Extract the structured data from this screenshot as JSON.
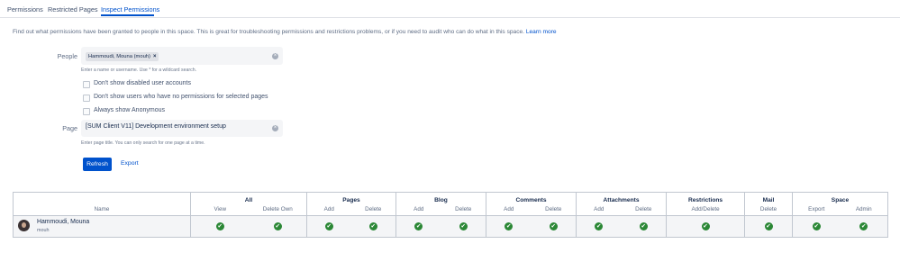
{
  "tabs": [
    {
      "label": "Permissions"
    },
    {
      "label": "Restricted Pages"
    },
    {
      "label": "Inspect Permissions"
    }
  ],
  "intro": {
    "text": "Find out what permissions have been granted to people in this space. This is great for troubleshooting permissions and restrictions problems, or if you need to audit who can do what in this space.",
    "link": "Learn more"
  },
  "people": {
    "label": "People",
    "chip": "Hammoudi, Mouna (mouh)",
    "hint": "Enter a name or username. Use * for a wildcard search."
  },
  "options": [
    {
      "label": "Don't show disabled user accounts"
    },
    {
      "label": "Don't show users who have no permissions for selected pages"
    },
    {
      "label": "Always show Anonymous"
    }
  ],
  "page": {
    "label": "Page",
    "value": "[SUM Client V11] Development environment setup",
    "hint": "Enter page title. You can only search for one page at a time."
  },
  "buttons": {
    "refresh": "Refresh",
    "export": "Export"
  },
  "table": {
    "name_header": "Name",
    "groups": [
      {
        "label": "All",
        "columns": [
          "View",
          "Delete Own"
        ]
      },
      {
        "label": "Pages",
        "columns": [
          "Add",
          "Delete"
        ]
      },
      {
        "label": "Blog",
        "columns": [
          "Add",
          "Delete"
        ]
      },
      {
        "label": "Comments",
        "columns": [
          "Add",
          "Delete"
        ]
      },
      {
        "label": "Attachments",
        "columns": [
          "Add",
          "Delete"
        ]
      },
      {
        "label": "Restrictions",
        "columns": [
          "Add/Delete"
        ]
      },
      {
        "label": "Mail",
        "columns": [
          "Delete"
        ]
      },
      {
        "label": "Space",
        "columns": [
          "Export",
          "Admin"
        ]
      }
    ],
    "rows": [
      {
        "name": "Hammoudi, Mouna",
        "username": "mouh",
        "permissions": [
          true,
          true,
          true,
          true,
          true,
          true,
          true,
          true,
          true,
          true,
          true,
          true,
          true,
          true
        ]
      }
    ]
  },
  "colors": {
    "accent": "#0052cc",
    "check": "#2a8735"
  },
  "icons": {
    "clear": "clear-icon",
    "check": "check-icon",
    "remove": "remove-icon"
  }
}
